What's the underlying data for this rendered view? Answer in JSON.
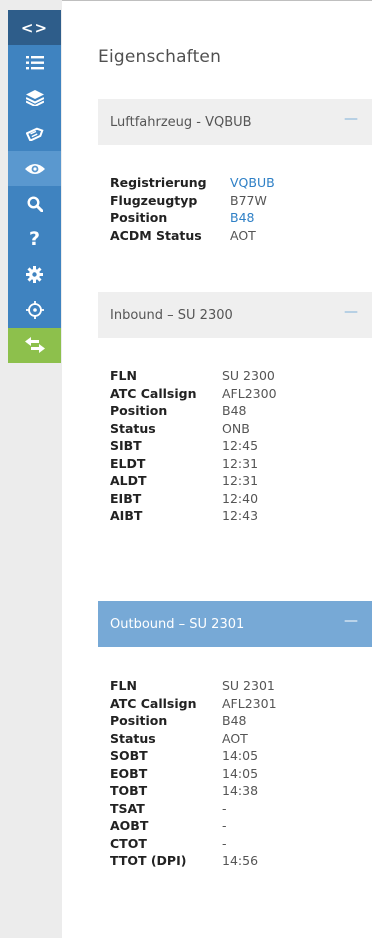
{
  "panel": {
    "title": "Eigenschaften"
  },
  "aircraft": {
    "header": "Luftfahrzeug - VQBUB",
    "toggle": "—",
    "rows": [
      {
        "label": "Registrierung",
        "value": "VQBUB"
      },
      {
        "label": "Flugzeugtyp",
        "value": "B77W"
      },
      {
        "label": "Position",
        "value": "B48"
      },
      {
        "label": "ACDM Status",
        "value": "AOT"
      }
    ]
  },
  "inbound": {
    "header": "Inbound – SU 2300",
    "toggle": "—",
    "rows": [
      {
        "label": "FLN",
        "value": "SU 2300"
      },
      {
        "label": "ATC Callsign",
        "value": "AFL2300"
      },
      {
        "label": "Position",
        "value": "B48"
      },
      {
        "label": "Status",
        "value": "ONB"
      },
      {
        "label": "SIBT",
        "value": "12:45"
      },
      {
        "label": "ELDT",
        "value": "12:31"
      },
      {
        "label": "ALDT",
        "value": "12:31"
      },
      {
        "label": "EIBT",
        "value": "12:40"
      },
      {
        "label": "AIBT",
        "value": "12:43"
      }
    ]
  },
  "outbound": {
    "header": "Outbound – SU 2301",
    "toggle": "—",
    "rows": [
      {
        "label": "FLN",
        "value": "SU 2301"
      },
      {
        "label": "ATC Callsign",
        "value": "AFL2301"
      },
      {
        "label": "Position",
        "value": "B48"
      },
      {
        "label": "Status",
        "value": "AOT"
      },
      {
        "label": "SOBT",
        "value": "14:05"
      },
      {
        "label": "EOBT",
        "value": "14:05"
      },
      {
        "label": "TOBT",
        "value": "14:38"
      },
      {
        "label": "TSAT",
        "value": "-"
      },
      {
        "label": "AOBT",
        "value": "-"
      },
      {
        "label": "CTOT",
        "value": "-"
      },
      {
        "label": "TTOT (DPI)",
        "value": "14:56"
      }
    ]
  },
  "rail": {
    "icons": [
      "code-brackets-icon",
      "list-icon",
      "layers-icon",
      "tag-icon",
      "eye-icon",
      "search-icon",
      "help-icon",
      "gear-icon",
      "target-icon",
      "swap-arrows-icon"
    ],
    "help_glyph": "?",
    "code_glyph": "<>"
  },
  "colors": {
    "rail_dark": "#2e5d8a",
    "rail_blue": "#3f83c0",
    "rail_green": "#8dc04c",
    "active_header": "#77a9d6",
    "link": "#2f80c6"
  }
}
